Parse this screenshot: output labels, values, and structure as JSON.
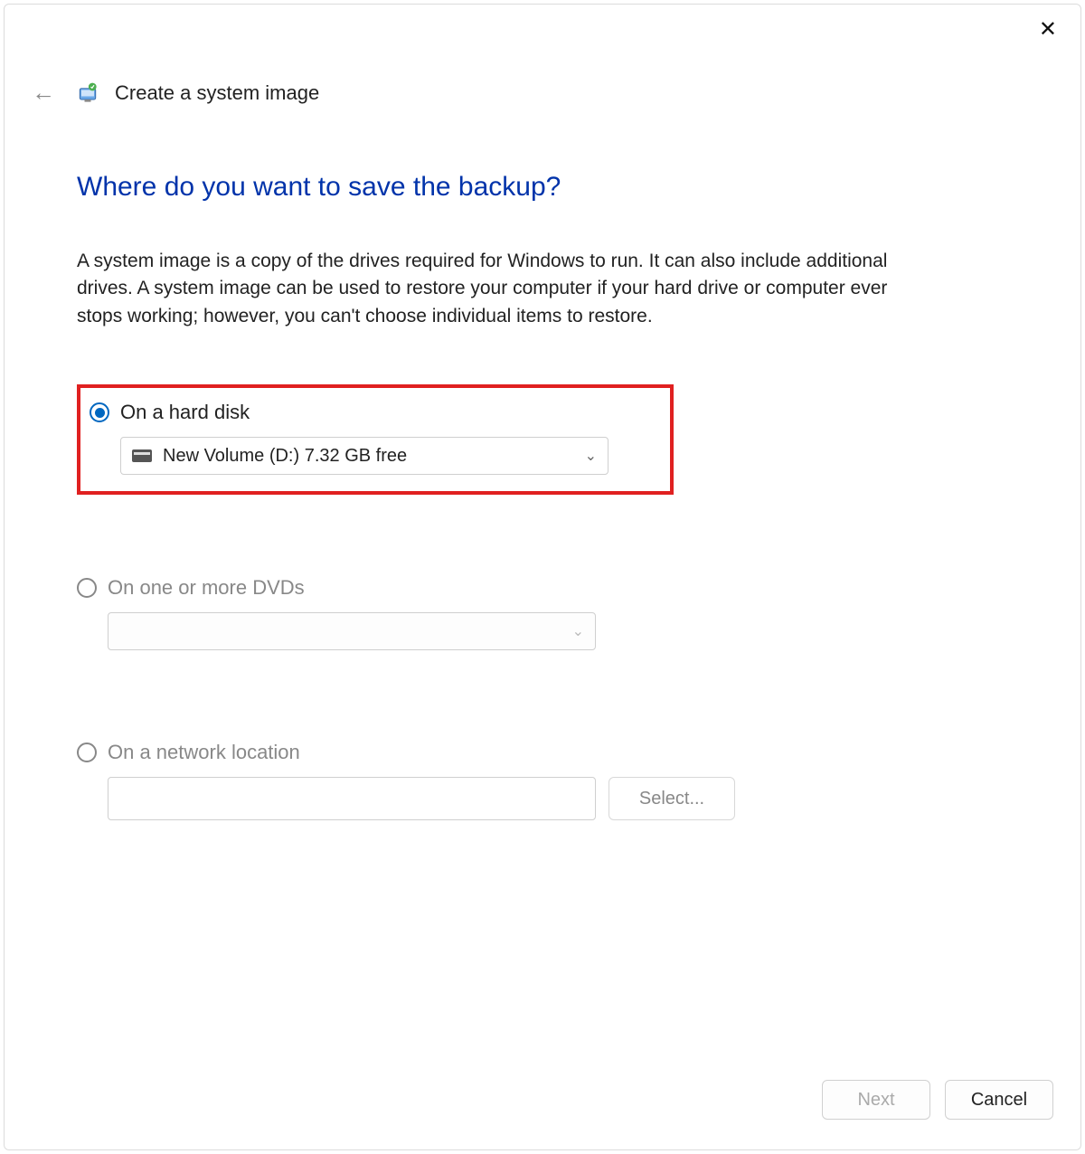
{
  "window": {
    "title": "Create a system image"
  },
  "page": {
    "heading": "Where do you want to save the backup?",
    "description": "A system image is a copy of the drives required for Windows to run. It can also include additional drives. A system image can be used to restore your computer if your hard drive or computer ever stops working; however, you can't choose individual items to restore."
  },
  "options": {
    "hard_disk": {
      "label": "On a hard disk",
      "selected": true,
      "drive_display": "New Volume (D:)  7.32 GB free"
    },
    "dvd": {
      "label": "On one or more DVDs",
      "selected": false,
      "drive_display": ""
    },
    "network": {
      "label": "On a network location",
      "selected": false,
      "path": "",
      "select_button": "Select..."
    }
  },
  "footer": {
    "next": "Next",
    "cancel": "Cancel"
  }
}
